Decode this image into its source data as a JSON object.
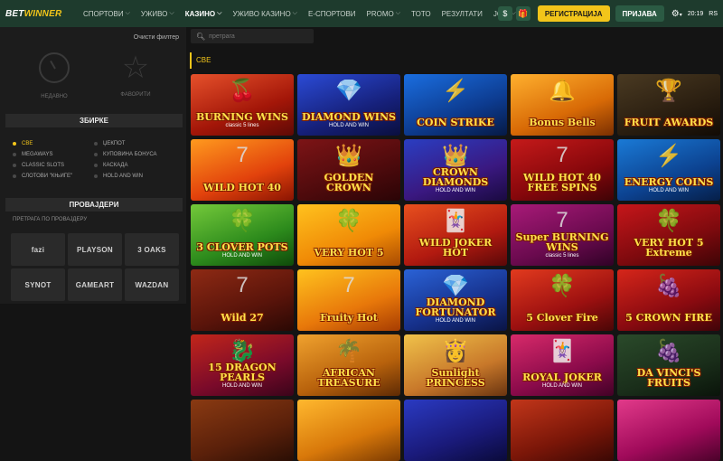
{
  "header": {
    "logo_a": "BET",
    "logo_b": "WINNER",
    "nav": [
      {
        "label": "СПОРТОВИ",
        "chev": true
      },
      {
        "label": "УЖИВО",
        "chev": true
      },
      {
        "label": "КАЗИНО",
        "chev": true,
        "active": true
      },
      {
        "label": "УЖИВО КАЗИНО",
        "chev": true
      },
      {
        "label": "Е-СПОРТОВИ",
        "chev": false
      },
      {
        "label": "PROMO",
        "chev": true
      },
      {
        "label": "ТОТО",
        "chev": false
      },
      {
        "label": "РЕЗУЛТАТИ",
        "chev": false
      },
      {
        "label": "ЈОШ",
        "chev": true
      }
    ],
    "dollar_icon": "$",
    "register_label": "РЕГИСТРАЦИЈА",
    "login_label": "ПРИЈАВА",
    "time": "20:19",
    "lang": "RS"
  },
  "sidebar": {
    "clear_filter": "Очисти филтер",
    "recent_label": "НЕДАВНО",
    "favorites_label": "ФАВОРИТИ",
    "collections_title": "ЗБИРКЕ",
    "collections": [
      {
        "label": "СВЕ",
        "active": true
      },
      {
        "label": "ЏЕКПОТ"
      },
      {
        "label": "MEGAWAYS"
      },
      {
        "label": "КУПОВИНА БОНУСА"
      },
      {
        "label": "CLASSIC SLOTS"
      },
      {
        "label": "КАСКАДА"
      },
      {
        "label": "СЛОТОВИ \"КЊИГЕ\""
      },
      {
        "label": "HOLD AND WIN"
      }
    ],
    "providers_title": "ПРОВАЈДЕРИ",
    "provider_search": "ПРЕТРАГА ПО ПРОВАЈДЕРУ",
    "providers": [
      "fazi",
      "PLAYSON",
      "3 OAKS",
      "SYNOT",
      "GAMEART",
      "WAZDAN"
    ]
  },
  "search": {
    "placeholder": "претрага"
  },
  "category": "СВЕ",
  "games": [
    {
      "title": "BURNING WINS",
      "sub": "classic 5 lines",
      "glyph": "🍒",
      "bg": "linear-gradient(160deg,#e6512b,#a31608 60%,#5e0a05)"
    },
    {
      "title": "DIAMOND WINS",
      "sub": "HOLD AND WIN",
      "glyph": "💎",
      "bg": "linear-gradient(160deg,#2b4bd6,#16207a 60%,#0a0f3e)"
    },
    {
      "title": "COIN STRIKE",
      "sub": "",
      "glyph": "⚡",
      "bg": "linear-gradient(160deg,#1a6ee0,#0d3b8f 60%,#061a45)"
    },
    {
      "title": "Bonus Bells",
      "sub": "",
      "glyph": "🔔",
      "bg": "linear-gradient(160deg,#ffb02e,#d86a06 60%,#7a2f02)"
    },
    {
      "title": "FRUIT AWARDS",
      "sub": "",
      "glyph": "🏆",
      "bg": "linear-gradient(160deg,#4a3a22,#2a1e10 60%,#120b05)"
    },
    {
      "title": "WILD HOT 40",
      "sub": "",
      "glyph": "7",
      "bg": "linear-gradient(160deg,#ff9a1e,#e2420c 60%,#8a1402)"
    },
    {
      "title": "GOLDEN CROWN",
      "sub": "",
      "glyph": "👑",
      "bg": "linear-gradient(160deg,#7d1416,#4d0a0c 60%,#2a0406)"
    },
    {
      "title": "CROWN DIAMONDS",
      "sub": "HOLD AND WIN",
      "glyph": "👑",
      "bg": "linear-gradient(160deg,#2a3ec2,#3a1880 60%,#1a0a40)"
    },
    {
      "title": "WILD HOT 40 FREE SPINS",
      "sub": "",
      "glyph": "7",
      "bg": "linear-gradient(160deg,#c51a1a,#86070b 60%,#3e0306)"
    },
    {
      "title": "ENERGY COINS",
      "sub": "HOLD AND WIN",
      "glyph": "⚡",
      "bg": "linear-gradient(160deg,#1a7ad6,#0c4290 60%,#061f48)"
    },
    {
      "title": "3 CLOVER POTS",
      "sub": "HOLD AND WIN",
      "glyph": "🍀",
      "bg": "linear-gradient(160deg,#74c93a,#2c8a1c 60%,#0f4a0a)"
    },
    {
      "title": "VERY HOT 5",
      "sub": "",
      "glyph": "🍀",
      "bg": "linear-gradient(160deg,#ffc21e,#f08a06 60%,#a84a02)"
    },
    {
      "title": "WILD JOKER HOT",
      "sub": "",
      "glyph": "🃏",
      "bg": "linear-gradient(160deg,#e8501e,#b21a10 60%,#5a0808)"
    },
    {
      "title": "Super BURNING WINS",
      "sub": "classic 5 lines",
      "glyph": "7",
      "bg": "linear-gradient(160deg,#a81a78,#6a0a4e 60%,#300226)"
    },
    {
      "title": "VERY HOT 5 Extreme",
      "sub": "",
      "glyph": "🍀",
      "bg": "linear-gradient(160deg,#c6161a,#7e0a0e 60%,#3e0406)"
    },
    {
      "title": "Wild 27",
      "sub": "",
      "glyph": "7",
      "bg": "linear-gradient(160deg,#8e2a14,#5a140a 60%,#2a0804)"
    },
    {
      "title": "Fruity Hot",
      "sub": "",
      "glyph": "7",
      "bg": "linear-gradient(160deg,#ffc21e,#e8780a 60%,#a63c02)"
    },
    {
      "title": "DIAMOND FORTUNATOR",
      "sub": "HOLD AND WIN",
      "glyph": "💎",
      "bg": "linear-gradient(160deg,#2a62d6,#16308a 60%,#0a1444)"
    },
    {
      "title": "5 Clover Fire",
      "sub": "",
      "glyph": "🍀",
      "bg": "linear-gradient(160deg,#e23a1e,#9c1010 60%,#4a0606)"
    },
    {
      "title": "5 CROWN FIRE",
      "sub": "",
      "glyph": "🍇",
      "bg": "linear-gradient(160deg,#d6261a,#8a0a10 60%,#400408)"
    },
    {
      "title": "15 DRAGON PEARLS",
      "sub": "HOLD AND WIN",
      "glyph": "🐉",
      "bg": "linear-gradient(160deg,#c2261a,#7a0a2a 60%,#3a041a)"
    },
    {
      "title": "AFRICAN TREASURE",
      "sub": "",
      "glyph": "🌴",
      "bg": "linear-gradient(160deg,#f0a22e,#b8620c 60%,#5e2a04)"
    },
    {
      "title": "Sunlight PRINCESS",
      "sub": "",
      "glyph": "👸",
      "bg": "linear-gradient(160deg,#f0c24a,#c8782a 60%,#6a3410)"
    },
    {
      "title": "ROYAL JOKER",
      "sub": "HOLD AND WIN",
      "glyph": "🃏",
      "bg": "linear-gradient(160deg,#d82a6a,#8a0a4a 60%,#420226)"
    },
    {
      "title": "DA VINCI'S FRUITS",
      "sub": "",
      "glyph": "🍇",
      "bg": "linear-gradient(160deg,#2a4a2a,#1a2e1a 60%,#0a140a)"
    },
    {
      "title": "",
      "sub": "",
      "glyph": "",
      "bg": "linear-gradient(160deg,#8a3a12,#5a200a 60%,#2a0e04)"
    },
    {
      "title": "",
      "sub": "",
      "glyph": "",
      "bg": "linear-gradient(160deg,#ffb82e,#d8780a 60%,#7a3a02)"
    },
    {
      "title": "",
      "sub": "",
      "glyph": "",
      "bg": "linear-gradient(160deg,#2a3ac2,#1a1a7a 60%,#0a0a3a)"
    },
    {
      "title": "",
      "sub": "",
      "glyph": "",
      "bg": "linear-gradient(160deg,#c2361a,#7a1608 60%,#3a0804)"
    },
    {
      "title": "",
      "sub": "",
      "glyph": "",
      "bg": "linear-gradient(160deg,#e23a8a,#a00a5a 60%,#4a022a)"
    }
  ]
}
